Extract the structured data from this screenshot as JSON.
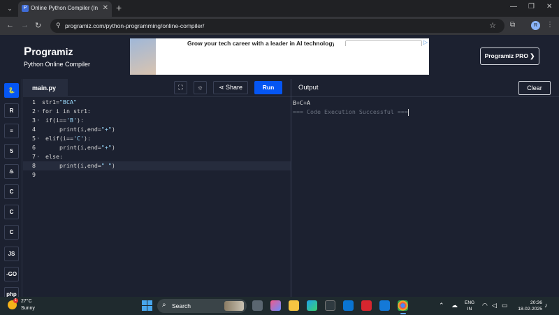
{
  "browser": {
    "tab_title": "Online Python Compiler (Interp",
    "url": "programiz.com/python-programming/online-compiler/",
    "profile_initial": "R"
  },
  "site": {
    "logo": "rogramiz",
    "logo_p": "P",
    "subtitle": "Python Online Compiler",
    "ad_text": "Grow your tech career with a leader in AI technology",
    "pro_button": "Programiz PRO ❯"
  },
  "sidebar": {
    "items": [
      {
        "name": "python",
        "label": "🐍"
      },
      {
        "name": "r",
        "label": "R"
      },
      {
        "name": "sql",
        "label": "≡"
      },
      {
        "name": "html",
        "label": "5"
      },
      {
        "name": "java",
        "label": "♨"
      },
      {
        "name": "c",
        "label": "C"
      },
      {
        "name": "cpp",
        "label": "C"
      },
      {
        "name": "csharp",
        "label": "C"
      },
      {
        "name": "js",
        "label": "JS"
      },
      {
        "name": "go",
        "label": "-GO"
      },
      {
        "name": "php",
        "label": "php"
      }
    ]
  },
  "editor": {
    "file_name": "main.py",
    "share_label": "Share",
    "run_label": "Run",
    "lines": [
      {
        "num": "1",
        "code": "str1=\"BCA\""
      },
      {
        "num": "2",
        "code": "for i in str1:"
      },
      {
        "num": "3",
        "code": " if(i=='B'):"
      },
      {
        "num": "4",
        "code": "     print(i,end=\"+\")"
      },
      {
        "num": "5",
        "code": " elif(i=='C'):"
      },
      {
        "num": "6",
        "code": "     print(i,end=\"+\")"
      },
      {
        "num": "7",
        "code": " else:"
      },
      {
        "num": "8",
        "code": "     print(i,end=\" \")"
      },
      {
        "num": "9",
        "code": ""
      }
    ]
  },
  "output": {
    "title": "Output",
    "clear_label": "Clear",
    "result": "B+C+A",
    "status": "=== Code Execution Successful ==="
  },
  "taskbar": {
    "temperature": "27°C",
    "condition": "Sunny",
    "search_label": "Search",
    "lang_1": "ENG",
    "lang_2": "IN",
    "time": "20:36",
    "date": "18-02-2025",
    "weather_badge": "1"
  }
}
